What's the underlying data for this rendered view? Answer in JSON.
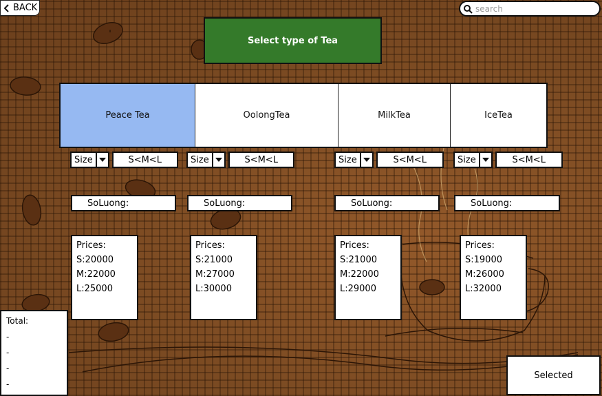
{
  "header": {
    "back_label": "BACK",
    "search_placeholder": "search",
    "title": "Select type of Tea"
  },
  "tabs": [
    {
      "label": "Peace Tea",
      "active": true
    },
    {
      "label": "OolongTea",
      "active": false
    },
    {
      "label": "MilkTea",
      "active": false
    },
    {
      "label": "IceTea",
      "active": false
    }
  ],
  "columns": [
    {
      "size_label": "Size",
      "size_value": "S<M<L",
      "quantity_label": "SoLuong:",
      "prices_title": "Prices:",
      "prices": [
        "S:20000",
        "M:22000",
        "L:25000"
      ]
    },
    {
      "size_label": "Size",
      "size_value": "S<M<L",
      "quantity_label": "SoLuong:",
      "prices_title": "Prices:",
      "prices": [
        "S:21000",
        "M:27000",
        "L:30000"
      ]
    },
    {
      "size_label": "Size",
      "size_value": "S<M<L",
      "quantity_label": "SoLuong:",
      "prices_title": "Prices:",
      "prices": [
        "S:21000",
        "M:22000",
        "L:29000"
      ]
    },
    {
      "size_label": "Size",
      "size_value": "S<M<L",
      "quantity_label": "SoLuong:",
      "prices_title": "Prices:",
      "prices": [
        "S:19000",
        "M:26000",
        "L:32000"
      ]
    }
  ],
  "total": {
    "label": "Total:",
    "lines": [
      "-",
      "-",
      "-",
      "-"
    ]
  },
  "selected_label": "Selected",
  "colors": {
    "active_tab": "#96b9f2",
    "banner": "#347a2a",
    "background": "#7a4a22"
  }
}
